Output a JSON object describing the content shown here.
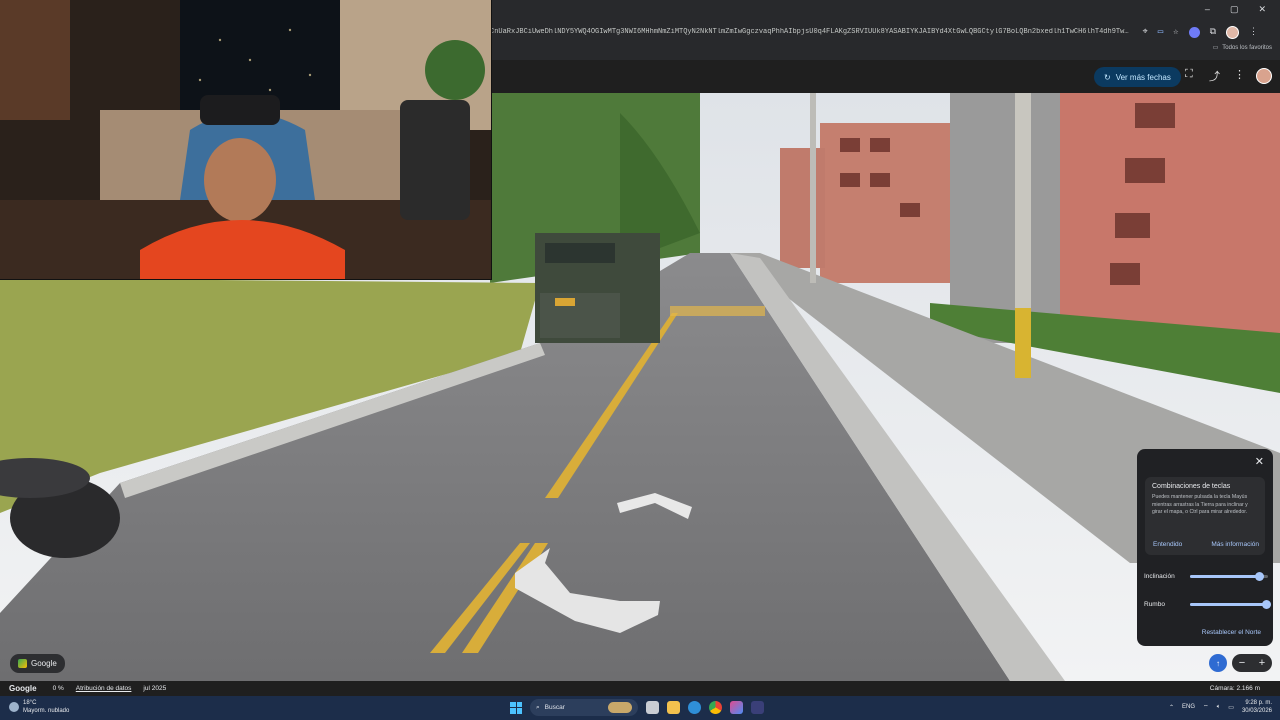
{
  "browser": {
    "url": "CnUaRxJBCiUweDhlNDY5YWQ4OGIwMTg3NWI6MHhmNmZiMTQyN2NkNTlmZmIwGgczvaqPhhAIbpjsU0q4FLAKgZSRVIUUk8YASABIYKJAIBYd4XtGwLQBGCtylG7BoLQBn2bxedlh1TwCH6lhT4dh9TwEICCAEiGgo...",
    "bookmarks_label": "Todos los favoritos",
    "window_controls": [
      "–",
      "▢",
      "✕"
    ]
  },
  "maps_header": {
    "dates_button": "Ver más fechas"
  },
  "scene_description_icons": {
    "nav_arrow_forward": "chevron-up-icon",
    "nav_arrow_back": "chevron-down-icon"
  },
  "google_chip": {
    "label": "Google"
  },
  "panel": {
    "tip_title": "Combinaciones de teclas",
    "tip_body": "Puedes mantener pulsada la tecla Mayús mientras arrastras la Tierra para inclinar y girar el mapa, o Ctrl para mirar alrededor.",
    "tip_ok": "Entendido",
    "tip_more": "Más información",
    "tilt_label": "Inclinación",
    "tilt_value": 0.88,
    "heading_label": "Rumbo",
    "heading_value": 0.98,
    "reset_label": "Restablecer el Norte"
  },
  "statusbar": {
    "brand": "Google",
    "zoom": "0 %",
    "attribution": "Atribución de datos",
    "date": "jul 2025",
    "camera": "Cámara: 2.166 m"
  },
  "taskbar": {
    "temp": "18°C",
    "weather": "Mayorm. nublado",
    "search": "Buscar",
    "lang": "ENG",
    "time": "9:28 p. m.",
    "date": "30/03/2026"
  }
}
